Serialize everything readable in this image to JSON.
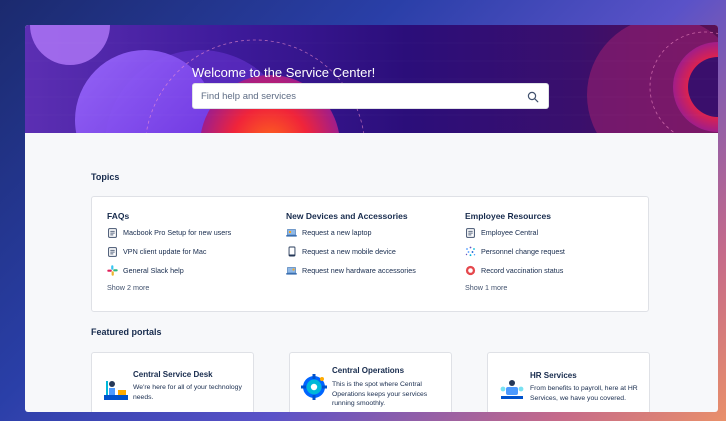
{
  "hero": {
    "title": "Welcome to the Service Center!",
    "search_placeholder": "Find help and services"
  },
  "topics": {
    "heading": "Topics",
    "columns": [
      {
        "title": "FAQs",
        "items": [
          {
            "label": "Macbook Pro Setup for new users",
            "icon": "document-icon"
          },
          {
            "label": "VPN client update for Mac",
            "icon": "document-icon"
          },
          {
            "label": "General Slack help",
            "icon": "slack-icon"
          }
        ],
        "show_more": "Show 2 more"
      },
      {
        "title": "New Devices and Accessories",
        "items": [
          {
            "label": "Request a new laptop",
            "icon": "laptop-icon"
          },
          {
            "label": "Request a new mobile device",
            "icon": "mobile-icon"
          },
          {
            "label": "Request new hardware accessories",
            "icon": "hardware-icon"
          }
        ]
      },
      {
        "title": "Employee Resources",
        "items": [
          {
            "label": "Employee Central",
            "icon": "document-icon"
          },
          {
            "label": "Personnel change request",
            "icon": "sparkle-icon"
          },
          {
            "label": "Record vaccination status",
            "icon": "record-icon"
          }
        ],
        "show_more": "Show 1 more"
      }
    ]
  },
  "featured": {
    "heading": "Featured portals",
    "portals": [
      {
        "title": "Central Service Desk",
        "desc": "We're here for all of your technology needs.",
        "icon": "service-desk-icon"
      },
      {
        "title": "Central Operations",
        "desc": "This is the spot where Central Operations keeps your services running smoothly.",
        "icon": "operations-icon"
      },
      {
        "title": "HR Services",
        "desc": "From benefits to payroll, here at HR Services, we have you covered.",
        "icon": "hr-services-icon"
      }
    ]
  },
  "colors": {
    "text": "#172b4d",
    "muted": "#42526e",
    "border": "#dfe1e6",
    "hero_purple": "#3d1a9a",
    "hero_orange": "#f04a23"
  }
}
